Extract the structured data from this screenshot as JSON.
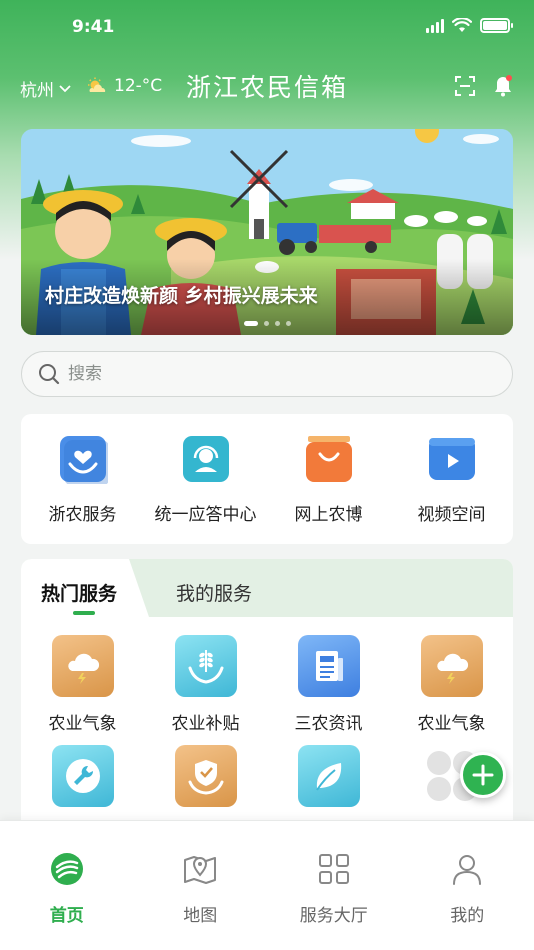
{
  "status_bar": {
    "time": "9:41"
  },
  "header": {
    "city": "杭州",
    "temperature": "12-°C",
    "title": "浙江农民信箱",
    "icons": [
      "weather-sun-cloud-icon",
      "scan-icon",
      "bell-icon"
    ]
  },
  "banner": {
    "caption": "村庄改造焕新颜 乡村振兴展未来",
    "slide_count": 4,
    "active_slide": 1
  },
  "search": {
    "placeholder": "搜索"
  },
  "quick_services": [
    {
      "label": "浙农服务",
      "icon": "heart-hands-icon",
      "color": "#4a8ee8"
    },
    {
      "label": "统一应答中心",
      "icon": "headset-agent-icon",
      "color": "#34b6cf"
    },
    {
      "label": "网上农博",
      "icon": "shopping-bag-icon",
      "color": "#f27a3a"
    },
    {
      "label": "视频空间",
      "icon": "video-play-icon",
      "color": "#3d86e4"
    }
  ],
  "services": {
    "tabs": [
      {
        "label": "热门服务",
        "active": true
      },
      {
        "label": "我的服务",
        "active": false
      }
    ],
    "items": [
      {
        "label": "农业气象",
        "icon": "cloud-storm-icon",
        "tile": "orange"
      },
      {
        "label": "农业补贴",
        "icon": "wheat-hands-icon",
        "tile": "cyan"
      },
      {
        "label": "三农资讯",
        "icon": "news-doc-icon",
        "tile": "blue"
      },
      {
        "label": "农业气象",
        "icon": "cloud-storm-icon",
        "tile": "orange"
      },
      {
        "label": "",
        "icon": "wrench-icon",
        "tile": "cyan"
      },
      {
        "label": "",
        "icon": "shield-hands-icon",
        "tile": "orange"
      },
      {
        "label": "",
        "icon": "leaf-icon",
        "tile": "cyan"
      },
      {
        "label": "",
        "icon": "more-grid-icon",
        "tile": "gray"
      }
    ]
  },
  "fab": {
    "icon": "plus-icon"
  },
  "bottom_nav": [
    {
      "label": "首页",
      "icon": "home-logo-icon",
      "active": true
    },
    {
      "label": "地图",
      "icon": "map-pin-icon",
      "active": false
    },
    {
      "label": "服务大厅",
      "icon": "grid-icon",
      "active": false
    },
    {
      "label": "我的",
      "icon": "user-icon",
      "active": false
    }
  ],
  "colors": {
    "brand": "#2fae4e",
    "header_green": "#3fb35a"
  }
}
